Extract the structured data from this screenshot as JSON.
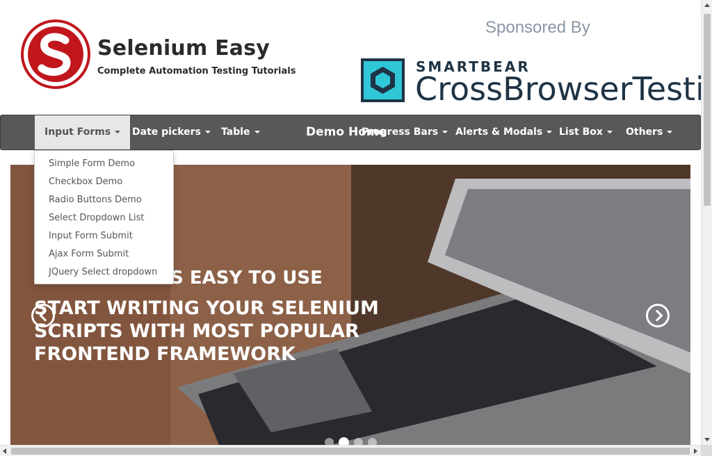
{
  "brand": {
    "name": "Selenium Easy",
    "tagline": "Complete Automation Testing Tutorials",
    "logo_icon": "selenium-easy-logo-icon",
    "accent": "#c0161c"
  },
  "sponsor": {
    "heading": "Sponsored By",
    "small": "SMARTBEAR",
    "big": "CrossBrowserTesting",
    "logo_icon": "smartbear-logo-icon",
    "logo_color": "#2fc7d8"
  },
  "navbar": {
    "background": "#585858",
    "items": [
      {
        "label": "Input Forms",
        "active": true
      },
      {
        "label": "Date pickers"
      },
      {
        "label": "Table"
      },
      {
        "label": "Progress Bars"
      },
      {
        "label": "Alerts & Modals"
      },
      {
        "label": "List Box"
      },
      {
        "label": "Others"
      }
    ],
    "center_label": "Demo Home"
  },
  "dropdown": {
    "items": [
      "Simple Form Demo",
      "Checkbox Demo",
      "Radio Buttons Demo",
      "Select Dropdown List",
      "Input Form Submit",
      "Ajax Form Submit",
      "JQuery Select dropdown"
    ]
  },
  "carousel": {
    "caption_small": "BOOTSTRAP IS EASY TO USE",
    "caption_big": "START WRITING YOUR SELENIUM SCRIPTS WITH MOST POPULAR FRONTEND FRAMEWORK",
    "prev_icon": "chevron-left-icon",
    "next_icon": "chevron-right-icon",
    "slide_count": 4,
    "active_slide": 2
  }
}
